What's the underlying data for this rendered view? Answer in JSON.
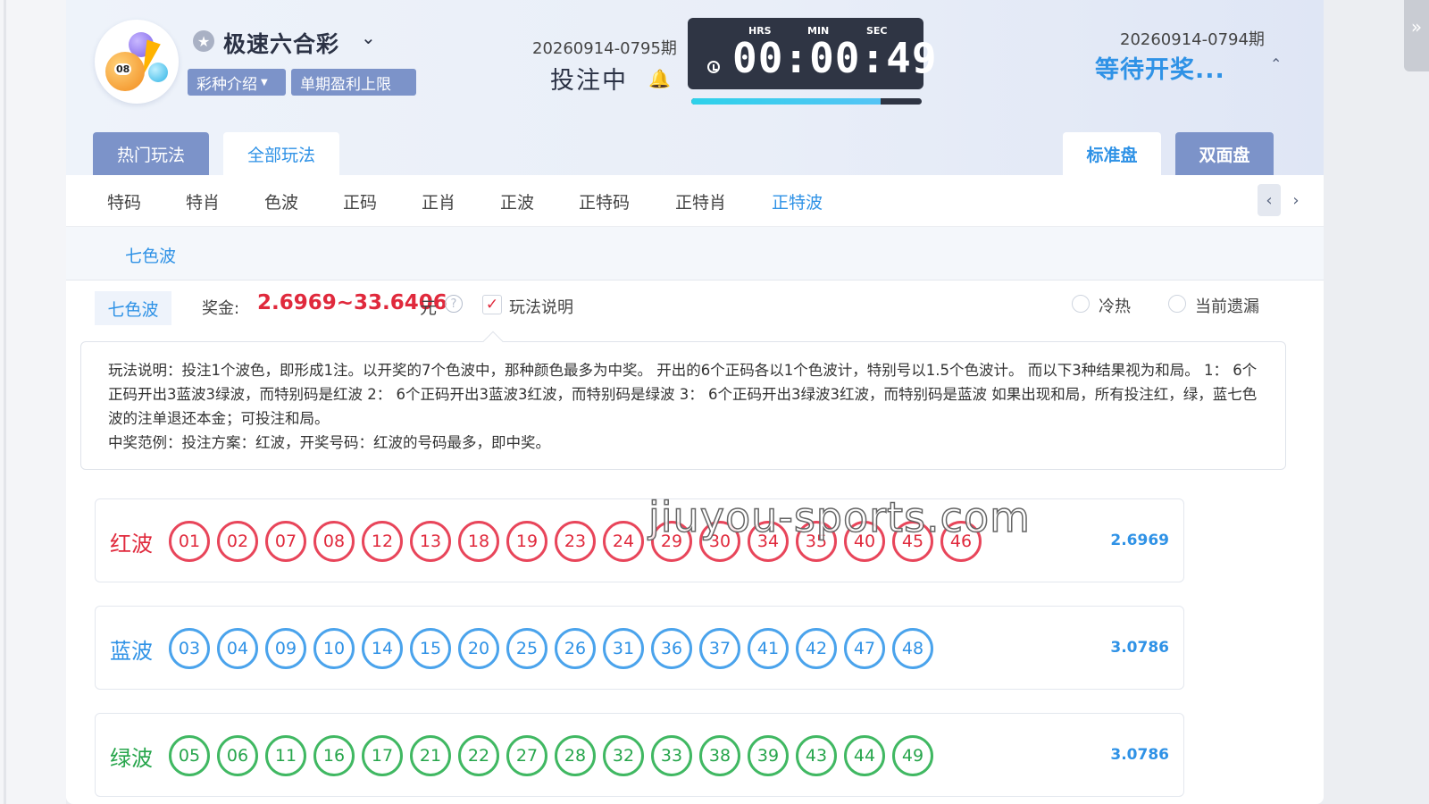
{
  "header": {
    "lottery_name": "极速六合彩",
    "intro_btn": "彩种介绍",
    "limit_btn": "单期盈利上限",
    "current_period": "20260914-0795期",
    "betting_status": "投注中",
    "timer": {
      "hrs_label": "HRS",
      "min_label": "MIN",
      "sec_label": "SEC",
      "value": "00:00:49",
      "progress": 0.82
    },
    "prev_period": "20260914-0794期",
    "prev_status": "等待开奖..."
  },
  "tabs": {
    "hot": "热门玩法",
    "all": "全部玩法",
    "standard": "标准盘",
    "double": "双面盘"
  },
  "subnav": [
    "特码",
    "特肖",
    "色波",
    "正码",
    "正肖",
    "正波",
    "正特码",
    "正特肖",
    "正特波"
  ],
  "subsub": {
    "item": "七色波"
  },
  "info": {
    "play_tag": "七色波",
    "prize_label": "奖金:",
    "prize_value": "2.6969~33.6406",
    "prize_unit": "元",
    "help": "?",
    "check_label": "玩法说明",
    "radio_hot": "冷热",
    "radio_miss": "当前遗漏"
  },
  "rules": {
    "line1": "玩法说明：投注1个波色，即形成1注。以开奖的7个色波中，那种颜色最多为中奖。 开出的6个正码各以1个色波计，特别号以1.5个色波计。 而以下3种结果视为和局。 1： 6个正码开出3蓝波3绿波，而特别码是红波 2： 6个正码开出3蓝波3红波，而特别码是绿波 3： 6个正码开出3绿波3红波，而特别码是蓝波 如果出现和局，所有投注红，绿，蓝七色波的注单退还本金；可投注和局。",
    "line2": "中奖范例：投注方案：红波，开奖号码：红波的号码最多，即中奖。"
  },
  "rows": {
    "red": {
      "label": "红波",
      "odds": "2.6969",
      "balls": [
        "01",
        "02",
        "07",
        "08",
        "12",
        "13",
        "18",
        "19",
        "23",
        "24",
        "29",
        "30",
        "34",
        "35",
        "40",
        "45",
        "46"
      ]
    },
    "blue": {
      "label": "蓝波",
      "odds": "3.0786",
      "balls": [
        "03",
        "04",
        "09",
        "10",
        "14",
        "15",
        "20",
        "25",
        "26",
        "31",
        "36",
        "37",
        "41",
        "42",
        "47",
        "48"
      ]
    },
    "green": {
      "label": "绿波",
      "odds": "3.0786",
      "balls": [
        "05",
        "06",
        "11",
        "16",
        "17",
        "21",
        "22",
        "27",
        "28",
        "32",
        "33",
        "38",
        "39",
        "43",
        "44",
        "49"
      ]
    }
  },
  "watermark": "jiuyou-sports.com",
  "colors": {
    "accent": "#2f92e6",
    "red": "#e0293c",
    "green": "#26a54b",
    "tab_bg": "#7c93c9",
    "timer_bg": "#2f3544"
  }
}
